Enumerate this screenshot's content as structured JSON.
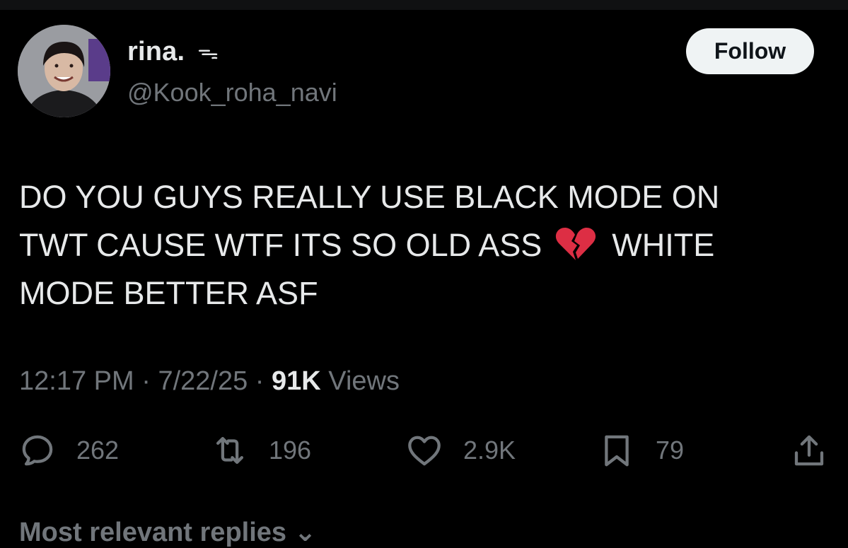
{
  "author": {
    "display_name": "rina.",
    "name_suffix": "ᯓ",
    "handle": "@Kook_roha_navi"
  },
  "follow_label": "Follow",
  "tweet": {
    "line1": "DO YOU GUYS REALLY USE BLACK MODE ON",
    "line2_before": "TWT CAUSE WTF ITS SO OLD ASS",
    "line2_after": "WHITE",
    "line3": "MODE BETTER ASF"
  },
  "meta": {
    "time": "12:17 PM",
    "sep1": " · ",
    "date": "7/22/25",
    "sep2": " · ",
    "views_count": "91K",
    "views_label": " Views"
  },
  "actions": {
    "replies": "262",
    "reposts": "196",
    "likes": "2.9K",
    "bookmarks": "79"
  },
  "replies_filter": "Most relevant replies ⌄",
  "colors": {
    "background": "#000000",
    "text": "#e7e9ea",
    "muted": "#71767b",
    "follow_bg": "#eff3f4",
    "emoji_red": "#dd2e44"
  }
}
